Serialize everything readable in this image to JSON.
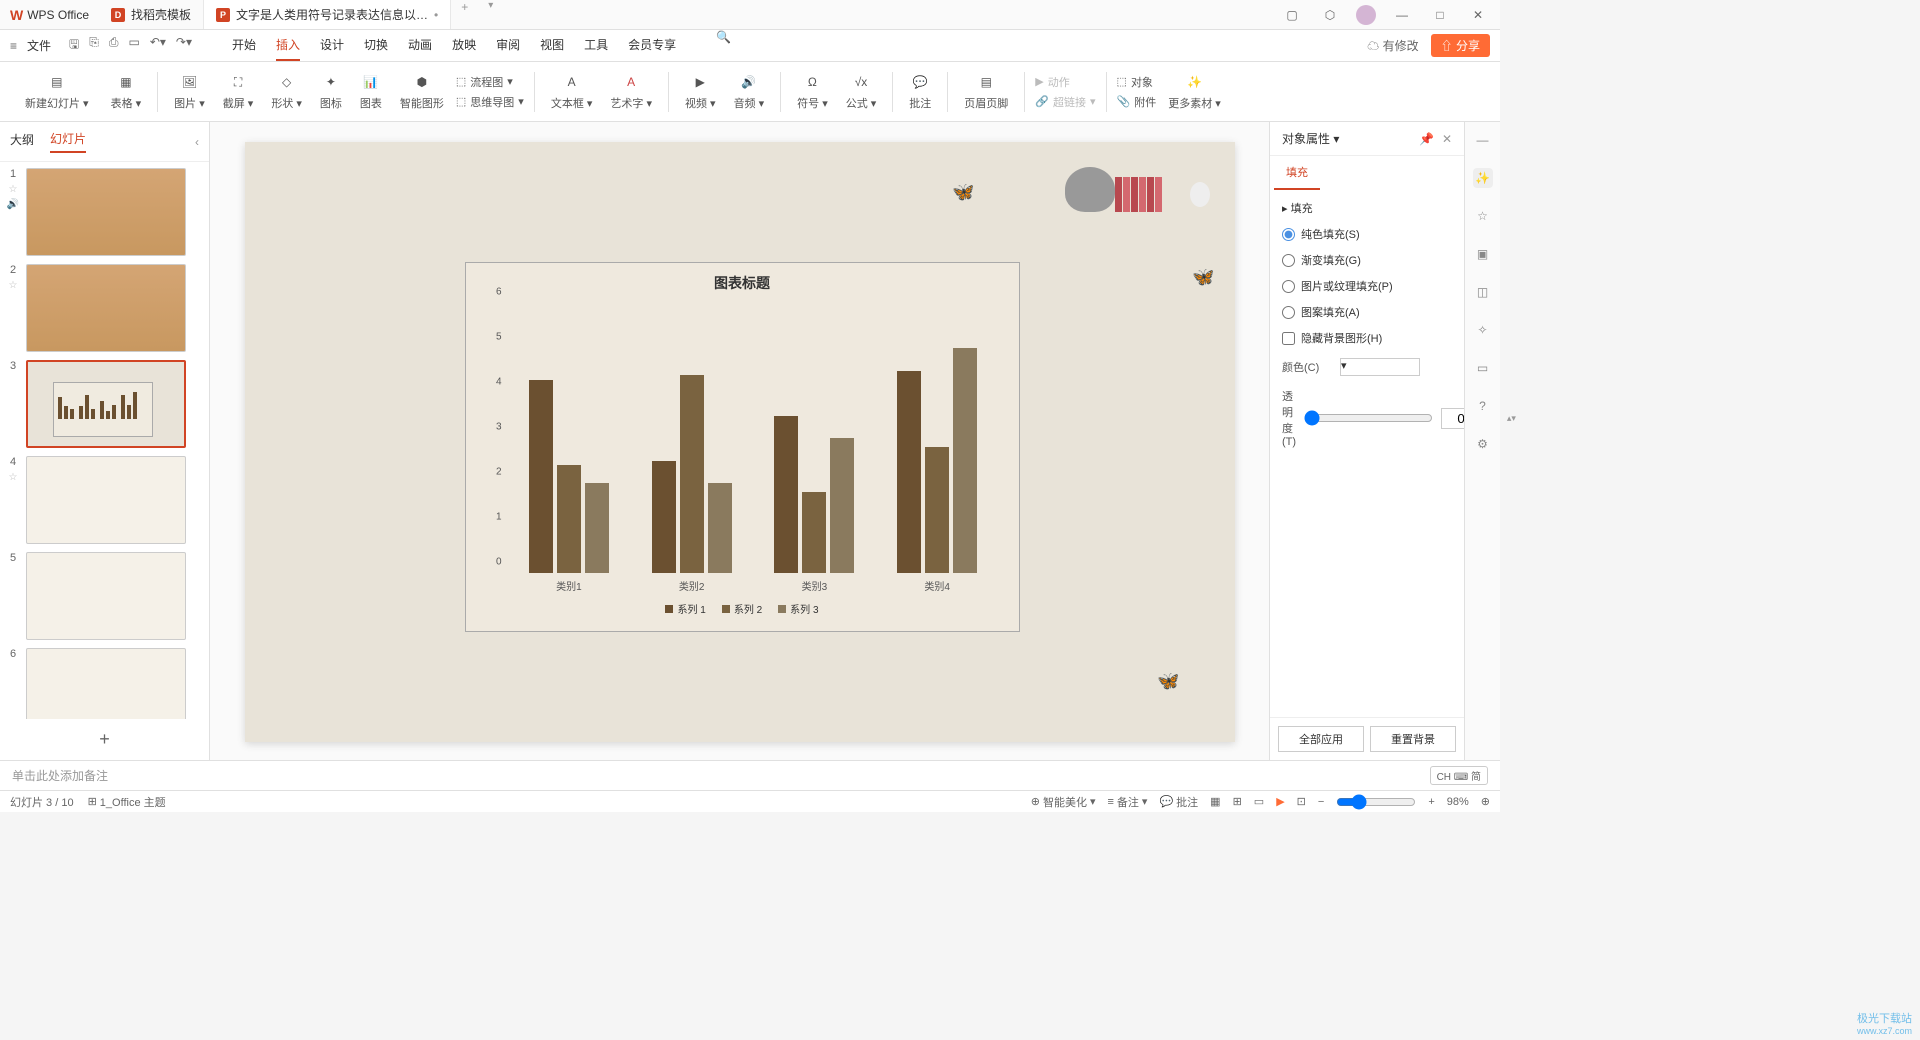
{
  "app_name": "WPS Office",
  "tabs_top": [
    {
      "label": "找稻壳模板"
    },
    {
      "label": "文字是人类用符号记录表达信息以…"
    }
  ],
  "title_right": {
    "has_modify": "有修改"
  },
  "menu": {
    "file": "文件",
    "items": [
      "开始",
      "插入",
      "设计",
      "切换",
      "动画",
      "放映",
      "审阅",
      "视图",
      "工具",
      "会员专享"
    ],
    "active": "插入",
    "share": "分享"
  },
  "ribbon": {
    "new_slide": "新建幻灯片",
    "table": "表格",
    "picture": "图片",
    "screenshot": "截屏",
    "shapes": "形状",
    "icons": "图标",
    "chart": "图表",
    "smartart": "智能图形",
    "flowchart": "流程图",
    "mindmap": "思维导图",
    "textbox": "文本框",
    "wordart": "艺术字",
    "video": "视频",
    "audio": "音频",
    "symbol": "符号",
    "equation": "公式",
    "comment": "批注",
    "header_footer": "页眉页脚",
    "action": "动作",
    "hyperlink": "超链接",
    "object": "对象",
    "attachment": "附件",
    "more": "更多素材"
  },
  "slide_panel": {
    "outline": "大纲",
    "slides": "幻灯片"
  },
  "chart_data": {
    "type": "bar",
    "title": "图表标题",
    "categories": [
      "类别1",
      "类别2",
      "类别3",
      "类别4"
    ],
    "series": [
      {
        "name": "系列 1",
        "values": [
          4.3,
          2.5,
          3.5,
          4.5
        ]
      },
      {
        "name": "系列 2",
        "values": [
          2.4,
          4.4,
          1.8,
          2.8
        ]
      },
      {
        "name": "系列 3",
        "values": [
          2.0,
          2.0,
          3.0,
          5.0
        ]
      }
    ],
    "ylim": [
      0,
      6
    ],
    "yticks": [
      0,
      1,
      2,
      3,
      4,
      5,
      6
    ]
  },
  "props": {
    "title": "对象属性",
    "fill_tab": "填充",
    "section": "填充",
    "solid": "纯色填充(S)",
    "gradient": "渐变填充(G)",
    "picture": "图片或纹理填充(P)",
    "pattern": "图案填充(A)",
    "hide_bg": "隐藏背景图形(H)",
    "color": "颜色(C)",
    "opacity": "透明度(T)",
    "opacity_val": "0",
    "opacity_unit": "%",
    "apply_all": "全部应用",
    "reset_bg": "重置背景"
  },
  "notes": {
    "placeholder": "单击此处添加备注"
  },
  "status": {
    "slide_pos": "幻灯片 3 / 10",
    "theme": "1_Office 主题",
    "smart_beauty": "智能美化",
    "notes": "备注",
    "comments": "批注",
    "ime": "CH ⌨ 简",
    "zoom": "98%"
  },
  "watermark": {
    "line1": "极光下载站",
    "line2": "www.xz7.com"
  }
}
